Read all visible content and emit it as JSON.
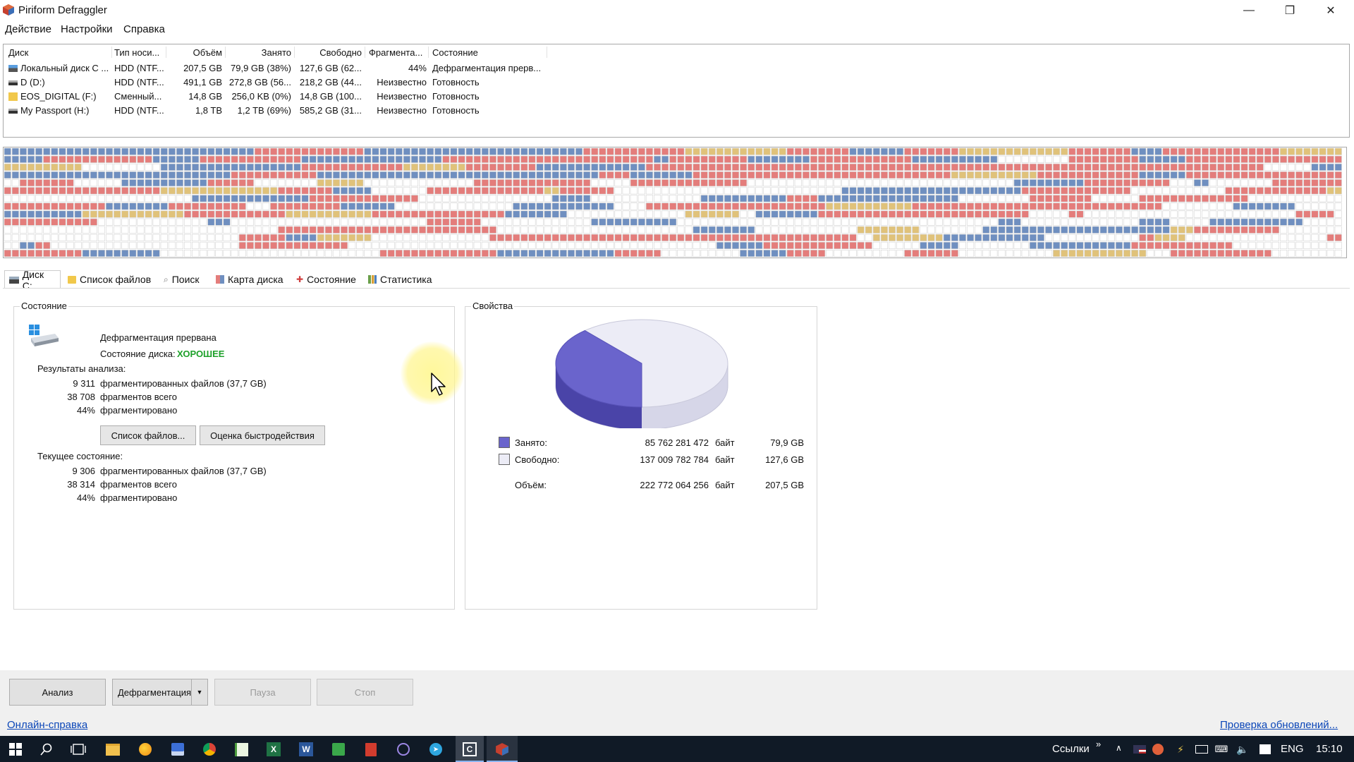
{
  "window": {
    "title": "Piriform Defraggler",
    "controls": [
      "—",
      "❐",
      "✕"
    ]
  },
  "menu": [
    "Действие",
    "Настройки",
    "Справка"
  ],
  "drives": {
    "columns": [
      "Диск",
      "Тип носи...",
      "Объём",
      "Занято",
      "Свободно",
      "Фрагмента...",
      "Состояние"
    ],
    "rows": [
      {
        "name": "Локальный диск C ...",
        "type": "HDD (NTF...",
        "size": "207,5 GB",
        "used": "79,9 GB (38%)",
        "free": "127,6 GB (62...",
        "frag": "44%",
        "state": "Дефрагментация прерв...",
        "icon": "windows-drive-icon"
      },
      {
        "name": "D (D:)",
        "type": "HDD (NTF...",
        "size": "491,1 GB",
        "used": "272,8 GB (56...",
        "free": "218,2 GB (44...",
        "frag": "Неизвестно",
        "state": "Готовность",
        "icon": "hdd-icon"
      },
      {
        "name": "EOS_DIGITAL (F:)",
        "type": "Сменный...",
        "size": "14,8 GB",
        "used": "256,0 KB (0%)",
        "free": "14,8 GB (100...",
        "frag": "Неизвестно",
        "state": "Готовность",
        "icon": "removable-drive-icon"
      },
      {
        "name": "My Passport (H:)",
        "type": "HDD (NTF...",
        "size": "1,8 TB",
        "used": "1,2 TB (69%)",
        "free": "585,2 GB (31...",
        "frag": "Неизвестно",
        "state": "Готовность",
        "icon": "hdd-icon"
      }
    ]
  },
  "cluster_colors": {
    "fragmented": "#e47d7b",
    "used": "#6f8fc0",
    "compressed": "#e0c27a",
    "free": "#ffffff"
  },
  "tabs": [
    "Диск C:",
    "Список файлов",
    "Поиск",
    "Карта диска",
    "Состояние",
    "Статистика"
  ],
  "status": {
    "group_title": "Состояние",
    "message": "Дефрагментация прервана",
    "health_label": "Состояние диска:",
    "health_value": "ХОРОШЕЕ",
    "analysis_title": "Результаты анализа:",
    "analysis": [
      {
        "num": "9 311",
        "text": "фрагментированных файлов (37,7 GB)"
      },
      {
        "num": "38 708",
        "text": "фрагментов всего"
      },
      {
        "num": "44%",
        "text": "фрагментировано"
      }
    ],
    "btn_file_list": "Список файлов...",
    "btn_benchmark": "Оценка быстродействия",
    "current_title": "Текущее состояние:",
    "current": [
      {
        "num": "9 306",
        "text": "фрагментированных файлов (37,7 GB)"
      },
      {
        "num": "38 314",
        "text": "фрагментов всего"
      },
      {
        "num": "44%",
        "text": "фрагментировано"
      }
    ]
  },
  "properties": {
    "group_title": "Свойства",
    "used_label": "Занято:",
    "used_bytes": "85 762 281 472",
    "used_unit": "байт",
    "used_gb": "79,9 GB",
    "free_label": "Свободно:",
    "free_bytes": "137 009 782 784",
    "free_unit": "байт",
    "free_gb": "127,6 GB",
    "total_label": "Объём:",
    "total_bytes": "222 772 064 256",
    "total_unit": "байт",
    "total_gb": "207,5 GB",
    "used_fraction": 0.385,
    "used_color": "#6a64cc",
    "free_color": "#ececf6"
  },
  "actions": {
    "analyze": "Анализ",
    "defrag": "Дефрагментация",
    "pause": "Пауза",
    "stop": "Стоп"
  },
  "links": {
    "help": "Онлайн-справка",
    "updates": "Проверка обновлений..."
  },
  "taskbar": {
    "links_label": "Ссылки",
    "lang": "ENG",
    "time": "15:10"
  }
}
